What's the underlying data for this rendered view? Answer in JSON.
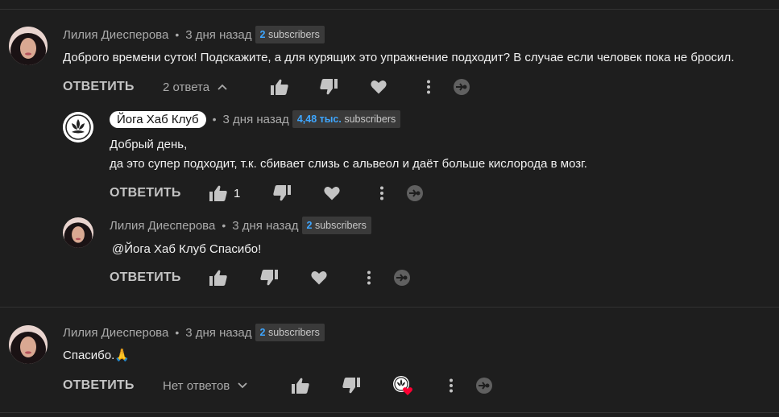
{
  "comments": [
    {
      "author": "Лилия Диесперова",
      "time": "3 дня назад",
      "subs_count": "2",
      "subs_label": "subscribers",
      "text": "Доброго времени суток! Подскажите, а для курящих это упражнение подходит? В случае если человек пока не бросил.",
      "reply_label": "ОТВЕТИТЬ",
      "replies_toggle": "2 ответа",
      "replies_expanded": true
    },
    {
      "author": "Йога Хаб Клуб",
      "author_highlighted": true,
      "time": "3 дня назад",
      "subs_count": "4,48 тыс.",
      "subs_label": "subscribers",
      "text_line1": "Добрый день,",
      "text_line2": "да это супер подходит, т.к. сбивает слизь с альвеол и даёт больше кислорода в мозг.",
      "reply_label": "ОТВЕТИТЬ",
      "like_count": "1"
    },
    {
      "author": "Лилия Диесперова",
      "time": "3 дня назад",
      "subs_count": "2",
      "subs_label": "subscribers",
      "text": "@Йога Хаб Клуб  Спасибо!",
      "reply_label": "ОТВЕТИТЬ"
    },
    {
      "author": "Лилия Диесперова",
      "time": "3 дня назад",
      "subs_count": "2",
      "subs_label": "subscribers",
      "text": "Спасибо.",
      "text_emoji": "🙏",
      "reply_label": "ОТВЕТИТЬ",
      "replies_toggle": "Нет ответов",
      "hearted_by_creator": true
    }
  ],
  "icons": {
    "like": "thumb-up-icon",
    "dislike": "thumb-down-icon",
    "heart": "heart-icon",
    "more": "more-vert-icon",
    "extension": "extension-badge-icon"
  },
  "colors": {
    "background": "#1e1e1e",
    "text": "#f1f1f1",
    "muted": "#aaaaaa",
    "subs_count": "#3ea6ff",
    "heart_red": "#ff0033"
  }
}
